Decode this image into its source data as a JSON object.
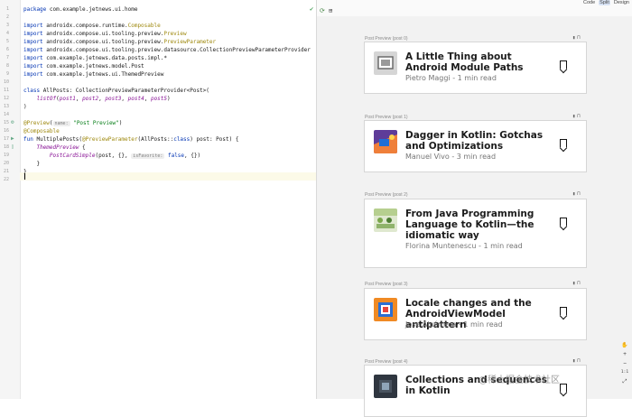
{
  "editor": {
    "line_numbers": [
      "1",
      "2",
      "3",
      "4",
      "5",
      "6",
      "7",
      "8",
      "9",
      "10",
      "11",
      "12",
      "13",
      "14",
      "15",
      "16",
      "17",
      "18",
      "19",
      "20",
      "21",
      "22"
    ],
    "lines": [
      {
        "t": [
          [
            "kw",
            "package "
          ],
          [
            "",
            "com.example.jetnews.ui.home"
          ]
        ]
      },
      {
        "t": []
      },
      {
        "t": [
          [
            "kw",
            "import "
          ],
          [
            "",
            "androidx.compose.runtime."
          ],
          [
            "ann",
            "Composable"
          ]
        ]
      },
      {
        "t": [
          [
            "kw",
            "import "
          ],
          [
            "",
            "androidx.compose.ui.tooling.preview."
          ],
          [
            "ann",
            "Preview"
          ]
        ]
      },
      {
        "t": [
          [
            "kw",
            "import "
          ],
          [
            "",
            "androidx.compose.ui.tooling.preview."
          ],
          [
            "ann",
            "PreviewParameter"
          ]
        ]
      },
      {
        "t": [
          [
            "kw",
            "import "
          ],
          [
            "",
            "androidx.compose.ui.tooling.preview.datasource.CollectionPreviewParameterProvider"
          ]
        ]
      },
      {
        "t": [
          [
            "kw",
            "import "
          ],
          [
            "",
            "com.example.jetnews.data.posts.impl.*"
          ]
        ]
      },
      {
        "t": [
          [
            "kw",
            "import "
          ],
          [
            "",
            "com.example.jetnews.model.Post"
          ]
        ]
      },
      {
        "t": [
          [
            "kw",
            "import "
          ],
          [
            "",
            "com.example.jetnews.ui.ThemedPreview"
          ]
        ]
      },
      {
        "t": []
      },
      {
        "t": [
          [
            "kw",
            "class "
          ],
          [
            "",
            "AllPosts: CollectionPreviewParameterProvider<Post>("
          ]
        ]
      },
      {
        "t": [
          [
            "",
            "    "
          ],
          [
            "it",
            "listOf"
          ],
          [
            "",
            "("
          ],
          [
            "it",
            "post1"
          ],
          [
            "",
            ", "
          ],
          [
            "it",
            "post2"
          ],
          [
            "",
            ", "
          ],
          [
            "it",
            "post3"
          ],
          [
            "",
            ", "
          ],
          [
            "it",
            "post4"
          ],
          [
            "",
            ", "
          ],
          [
            "it",
            "post5"
          ],
          [
            "",
            ")"
          ]
        ]
      },
      {
        "t": [
          [
            "",
            ")"
          ]
        ]
      },
      {
        "t": []
      },
      {
        "t": [
          [
            "ann",
            "@Preview"
          ],
          [
            "",
            "("
          ],
          [
            "hint",
            "name:"
          ],
          [
            "str",
            " \"Post Preview\""
          ],
          [
            "",
            ")"
          ]
        ]
      },
      {
        "t": [
          [
            "ann",
            "@Composable"
          ]
        ]
      },
      {
        "t": [
          [
            "kw",
            "fun "
          ],
          [
            "",
            "MultiplePosts("
          ],
          [
            "ann",
            "@PreviewParameter"
          ],
          [
            "",
            "(AllPosts::"
          ],
          [
            "kw",
            "class"
          ],
          [
            "",
            ") post: Post) {"
          ]
        ]
      },
      {
        "t": [
          [
            "",
            "    "
          ],
          [
            "it",
            "ThemedPreview"
          ],
          [
            "",
            " {"
          ]
        ]
      },
      {
        "t": [
          [
            "",
            "        "
          ],
          [
            "it",
            "PostCardSimple"
          ],
          [
            "",
            "(post, {}, "
          ],
          [
            "hint",
            "isFavorite:"
          ],
          [
            "kw",
            " false"
          ],
          [
            "",
            ", {})"
          ]
        ]
      },
      {
        "t": [
          [
            "",
            "    }"
          ]
        ]
      },
      {
        "t": [
          [
            "",
            "}"
          ]
        ]
      },
      {
        "t": []
      }
    ]
  },
  "toolbar": {
    "modes": [
      "Code",
      "Split",
      "Design"
    ],
    "active_mode": "Split",
    "refresh_icon": "refresh-icon",
    "layout_icon": "layout-icon"
  },
  "preview": {
    "label_prefix": "Post Preview",
    "items": [
      {
        "label": "Post Preview (post 0)",
        "title": "A Little Thing about Android Module Paths",
        "meta": "Pietro Maggi - 1 min read",
        "thumb": "gray-device"
      },
      {
        "label": "Post Preview (post 1)",
        "title": "Dagger in Kotlin: Gotchas and Optimizations",
        "meta": "Manuel Vivo - 3 min read",
        "thumb": "purple-orange"
      },
      {
        "label": "Post Preview (post 2)",
        "title": "From Java Programming Language to Kotlin—the idiomatic way",
        "meta": "Florina Muntenescu - 1 min read",
        "thumb": "green-figures"
      },
      {
        "label": "Post Preview (post 3)",
        "title": "Locale changes and the AndroidViewModel antipattern",
        "meta": "Jose Alcérreca - 1 min read",
        "thumb": "orange-blue"
      },
      {
        "label": "Post Preview (post 4)",
        "title": "Collections and sequences in Kotlin",
        "meta": "",
        "thumb": "dark"
      }
    ]
  },
  "zoom": {
    "buttons": [
      "✋",
      "+",
      "−",
      "1:1",
      "⤢"
    ]
  },
  "watermark": "@稀土掘金技术社区"
}
